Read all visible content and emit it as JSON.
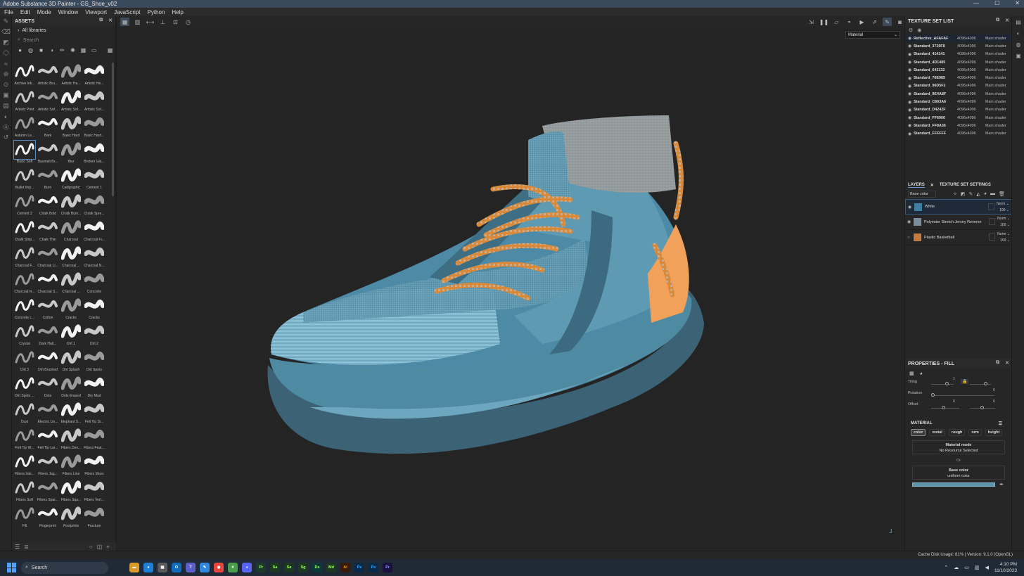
{
  "window": {
    "title": "Adobe Substance 3D Painter - GS_Shoe_v02"
  },
  "menu": [
    "File",
    "Edit",
    "Mode",
    "Window",
    "Viewport",
    "JavaScript",
    "Python",
    "Help"
  ],
  "assets": {
    "title": "ASSETS",
    "libraries": "All libraries",
    "search_placeholder": "Search",
    "brushes": [
      "Archive Ink...",
      "Artistic Bru...",
      "Artistic Ha...",
      "Artistic He...",
      "Artistic Print",
      "Artistic Sof...",
      "Artistic Sof...",
      "Artistic Sof...",
      "Autumn Le...",
      "Bark",
      "Basic Hard",
      "Basic Hard...",
      "Basic Soft",
      "Basmati Br...",
      "Blur",
      "Broken Gla...",
      "Bullet Imp...",
      "Burn",
      "Calligraphic",
      "Cement 1",
      "Cement 2",
      "Chalk Bold",
      "Chalk Bum...",
      "Chalk Spre...",
      "Chalk Strip...",
      "Chalk Thin",
      "Charcoal",
      "Charcoal Fi...",
      "Charcoal F...",
      "Charcoal Li...",
      "Charcoal ...",
      "Charcoal N...",
      "Charcoal R...",
      "Charcoal S...",
      "Charcoal ...",
      "Concrete",
      "Concrete L...",
      "Cotton",
      "Cracks",
      "Cracks",
      "Crystal",
      "Dark Halt...",
      "Dirt 1",
      "Dirt 2",
      "Dirt 3",
      "Dirt Brushed",
      "Dirt Splash",
      "Dirt Spots",
      "Dirt Spots ...",
      "Dots",
      "Dots Erased",
      "Dry Mud",
      "Dust",
      "Electric Lin...",
      "Elephant S...",
      "Felt Tip Si...",
      "Felt Tip W...",
      "Felt Tip Lar...",
      "Fibers Den...",
      "Fibers Feat...",
      "Fibers Inte...",
      "Fibers Jag...",
      "Fibers Line",
      "Fibers Moss",
      "Fibers Soft",
      "Fibers Spar...",
      "Fibers Squ...",
      "Fibers Vert...",
      "Fill",
      "Fingerprint",
      "Footprints",
      "Fracture"
    ],
    "selected_brush": "Basic Soft"
  },
  "viewport": {
    "material_mode": "Material"
  },
  "texture_set_list": {
    "title": "TEXTURE SET LIST",
    "rows": [
      {
        "name": "Reflective_AFAFAF",
        "res": "4096x4096",
        "shader": "Main shader"
      },
      {
        "name": "Standard_3729F8",
        "res": "4096x4096",
        "shader": "Main shader"
      },
      {
        "name": "Standard_414141",
        "res": "4096x4096",
        "shader": "Main shader"
      },
      {
        "name": "Standard_4D1485",
        "res": "4096x4096",
        "shader": "Main shader"
      },
      {
        "name": "Standard_643132",
        "res": "4096x4096",
        "shader": "Main shader"
      },
      {
        "name": "Standard_76E985",
        "res": "4096x4096",
        "shader": "Main shader"
      },
      {
        "name": "Standard_96D5F2",
        "res": "4096x4096",
        "shader": "Main shader"
      },
      {
        "name": "Standard_9E4A8F",
        "res": "4096x4096",
        "shader": "Main shader"
      },
      {
        "name": "Standard_C663A6",
        "res": "4096x4096",
        "shader": "Main shader"
      },
      {
        "name": "Standard_D4242F",
        "res": "4096x4096",
        "shader": "Main shader"
      },
      {
        "name": "Standard_FF6900",
        "res": "4096x4096",
        "shader": "Main shader"
      },
      {
        "name": "Standard_FF8A36",
        "res": "4096x4096",
        "shader": "Main shader"
      },
      {
        "name": "Standard_FFFFFF",
        "res": "4096x4096",
        "shader": "Main shader"
      }
    ]
  },
  "layers": {
    "tab_layers": "LAYERS",
    "tab_settings": "TEXTURE SET SETTINGS",
    "channel": "Base color",
    "rows": [
      {
        "name": "White",
        "blend": "Norm",
        "opacity": "100",
        "color": "#3f7fa0"
      },
      {
        "name": "Polyester Stretch Jersey Reverse",
        "blend": "Norm",
        "opacity": "100",
        "color": "#7b8d9a"
      },
      {
        "name": "Plastic Basketball",
        "blend": "Norm",
        "opacity": "100",
        "color": "#c77a3e"
      }
    ]
  },
  "properties": {
    "title": "PROPERTIES - FILL",
    "tiling_label": "Tiling",
    "tiling_value": "1",
    "rotation_label": "Rotation",
    "rotation_value": "0",
    "offset_label": "Offset",
    "offset_x": "0",
    "offset_y": "0",
    "material_title": "MATERIAL",
    "channels": [
      "color",
      "metal",
      "rough",
      "nrm",
      "height"
    ],
    "material_mode_label": "Material mode",
    "material_mode_value": "No Resource Selected",
    "or_label": "Or",
    "base_color_label": "Base color",
    "base_color_value": "uniform color",
    "base_color_hex": "#5e93a8"
  },
  "status": {
    "text": "Cache Disk Usage:  81% | Version: 9.1.0 (OpenGL)"
  },
  "taskbar": {
    "search": "Search",
    "time": "4:10 PM",
    "date": "11/10/2023",
    "apps": [
      "Pt",
      "Sa",
      "Sa",
      "Sg",
      "Ds",
      "Md",
      "Ai",
      "Ps",
      "Ps",
      "Pr"
    ]
  }
}
